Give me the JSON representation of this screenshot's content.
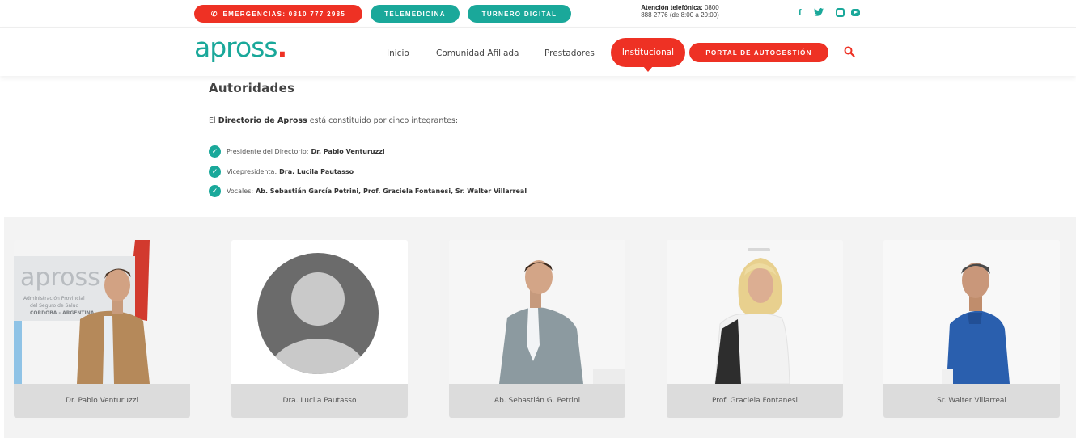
{
  "topbar": {
    "emergencias_label": "EMERGENCIAS: 0810 777 2985",
    "telemedicina_label": "TELEMEDICINA",
    "turnero_label": "TURNERO DIGITAL",
    "phone_label": "Atención telefónica:",
    "phone_number": "0800",
    "phone_line2": "888 2776 (de 8:00 a 20:00)",
    "social_icons": [
      "facebook-icon",
      "twitter-icon",
      "instagram-icon",
      "youtube-icon"
    ]
  },
  "nav": {
    "logo_text": "apross",
    "logo_dot": ".",
    "items": [
      {
        "label": "Inicio"
      },
      {
        "label": "Comunidad Afiliada"
      },
      {
        "label": "Prestadores"
      },
      {
        "label": "Institucional"
      }
    ],
    "portal_label": "PORTAL DE AUTOGESTIÓN"
  },
  "content": {
    "title": "Autoridades",
    "intro_prefix": "El",
    "intro_bold": "Directorio de Apross",
    "intro_suffix": "está constituido por cinco integrantes:",
    "list": [
      {
        "role": "Presidente del Directorio:",
        "name": "Dr. Pablo Venturuzzi"
      },
      {
        "role": "Vicepresidenta:",
        "name": "Dra. Lucila Pautasso"
      },
      {
        "role": "Vocales:",
        "name": "Ab. Sebastián García Petrini, Prof. Graciela Fontanesi, Sr. Walter Villarreal"
      }
    ]
  },
  "gallery": {
    "cards": [
      {
        "caption": "Dr. Pablo Venturuzzi"
      },
      {
        "caption": "Dra. Lucila Pautasso"
      },
      {
        "caption": "Ab. Sebastián G. Petrini"
      },
      {
        "caption": "Prof. Graciela Fontanesi"
      },
      {
        "caption": "Sr. Walter Villarreal"
      }
    ],
    "photo_sign": {
      "logo": "apross",
      "line1": "Administración Provincial",
      "line2": "del Seguro de Salud",
      "line3": "CÓRDOBA - ARGENTINA"
    }
  },
  "colors": {
    "brand_teal": "#1aa89a",
    "brand_red": "#ee3124",
    "caption_bg": "#dcdcdc",
    "gallery_bg": "#f3f3f3"
  }
}
